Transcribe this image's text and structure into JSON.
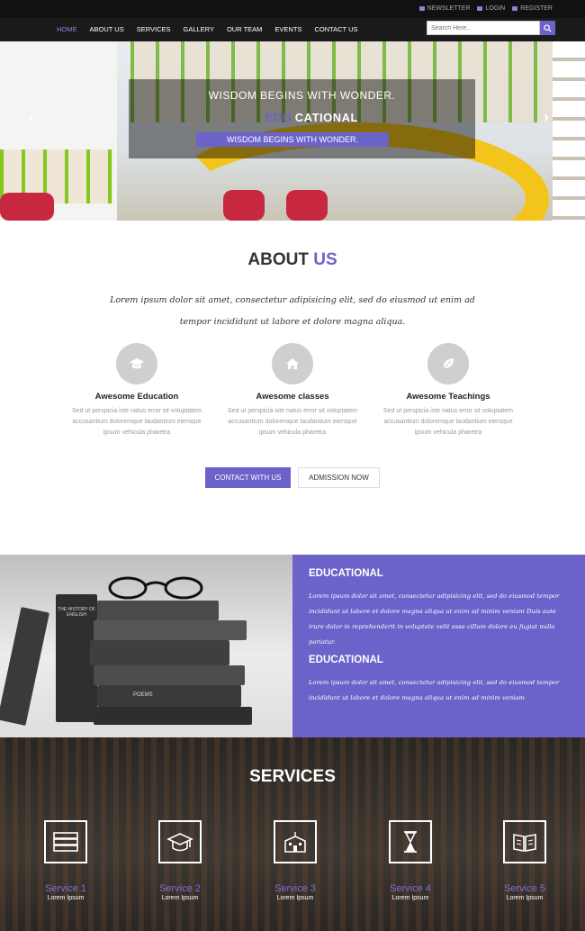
{
  "topbar": {
    "links": [
      "NEWSLETTER",
      "LOGIN",
      "REGISTER"
    ]
  },
  "nav": {
    "items": [
      "HOME",
      "ABOUT US",
      "SERVICES",
      "GALLERY",
      "OUR TEAM",
      "EVENTS",
      "CONTACT US"
    ],
    "active": "HOME",
    "search_placeholder": "Search Here.."
  },
  "hero": {
    "title": "WISDOM BEGINS WITH WONDER.",
    "subtitle_highlight": "EDU",
    "subtitle_rest": "CATIONAL",
    "button": "WISDOM BEGINS WITH WONDER.",
    "prev": "‹",
    "next": "›"
  },
  "about": {
    "title_plain": "ABOUT",
    "title_highlight": "US",
    "text": "Lorem ipsum dolor sit amet, consectetur adipisicing elit, sed do eiusmod ut enim ad tempor incididunt ut labore et dolore magna aliqua.",
    "features": [
      {
        "title": "Awesome Education",
        "desc": "Sed ut perspicia iste natus error sit voluptatem accusantium doloremque laudantium eiersque ipsum vehicula pharetra",
        "icon": "graduation-cap-icon"
      },
      {
        "title": "Awesome classes",
        "desc": "Sed ut perspicia iste natus error sit voluptatem accusantium doloremque laudantium eiersque ipsum vehicula pharetra",
        "icon": "home-icon"
      },
      {
        "title": "Awesome Teachings",
        "desc": "Sed ut perspicia iste natus error sit voluptatem accusantium doloremque laudantium eiersque ipsum vehicula pharetra",
        "icon": "leaf-icon"
      }
    ],
    "btn_contact": "CONTACT WITH US",
    "btn_admission": "ADMISSION NOW"
  },
  "educational": {
    "blocks": [
      {
        "heading": "EDUCATIONAL",
        "text": "Lorem ipsum dolor sit amet, consectetur adipisicing elit, sed do eiusmod tempor incididunt ut labore et dolore magna aliqua ut enim ad minim veniam Duis aute irure dolor in reprehenderit in voluptate velit esse cillum dolore eu fugiat nulla pariatur."
      },
      {
        "heading": "EDUCATIONAL",
        "text": "Lorem ipsum dolor sit amet, consectetur adipisicing elit, sed do eiusmod tempor incididunt ut labore et dolore magna aliqua ut enim ad minim veniam"
      }
    ],
    "book_titles": [
      "THE HISTORY OF ENGLISH",
      "POEMS"
    ]
  },
  "services": {
    "title": "SERVICES",
    "items": [
      {
        "name": "Service 1",
        "sub": "Lorem Ipsum",
        "icon": "books-icon"
      },
      {
        "name": "Service 2",
        "sub": "Lorem Ipsum",
        "icon": "graduation-cap-icon"
      },
      {
        "name": "Service 3",
        "sub": "Lorem Ipsum",
        "icon": "school-building-icon"
      },
      {
        "name": "Service 4",
        "sub": "Lorem Ipsum",
        "icon": "hourglass-icon"
      },
      {
        "name": "Service 5",
        "sub": "Lorem Ipsum",
        "icon": "open-book-icon"
      }
    ]
  },
  "colors": {
    "accent": "#6b63c9",
    "nav_bg": "#1b1b1b",
    "hero_yellow": "#f3c419"
  }
}
